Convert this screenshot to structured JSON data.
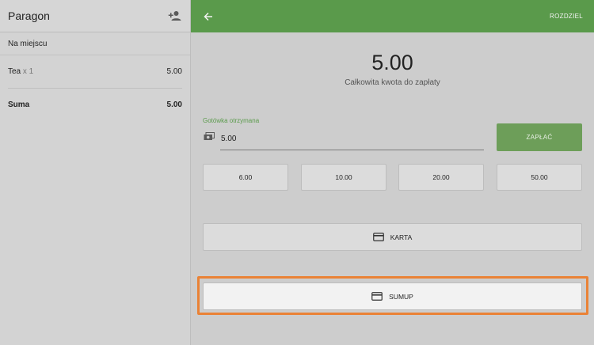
{
  "receipt": {
    "title": "Paragon",
    "add_customer_icon": "person-add-icon",
    "order_type": "Na miejscu",
    "items": [
      {
        "name": "Tea",
        "qty": "x 1",
        "price": "5.00"
      }
    ],
    "sum_label": "Suma",
    "sum_value": "5.00"
  },
  "payment": {
    "back_icon": "arrow-back-icon",
    "split_label": "ROZDZIEL",
    "amount": "5.00",
    "amount_caption": "Całkowita kwota do zapłaty",
    "cash_label": "Gotówka otrzymana",
    "cash_icon": "cash-icon",
    "cash_value": "5.00",
    "pay_label": "ZAPŁAĆ",
    "quick_amounts": [
      "6.00",
      "10.00",
      "20.00",
      "50.00"
    ],
    "card_label": "KARTA",
    "card_icon": "credit-card-icon",
    "sumup_label": "SUMUP",
    "sumup_icon": "credit-card-icon"
  },
  "colors": {
    "accent_green": "#5a9a4b",
    "pay_button": "#6d9e59",
    "highlight_orange": "#ea8236"
  }
}
